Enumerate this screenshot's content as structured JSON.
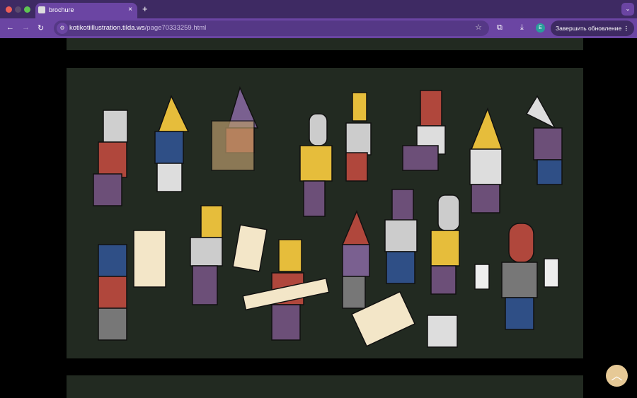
{
  "browser": {
    "tab": {
      "title": "brochure",
      "close": "×"
    },
    "new_tab": "+",
    "url_host": "kotikotiillustration.tilda.ws",
    "url_path": "/page70333259.html",
    "avatar": "E",
    "update_button": "Завершить обновление",
    "menu": "⋮"
  },
  "colors": {
    "chrome": "#6b45a3",
    "panel": "#222a21"
  }
}
